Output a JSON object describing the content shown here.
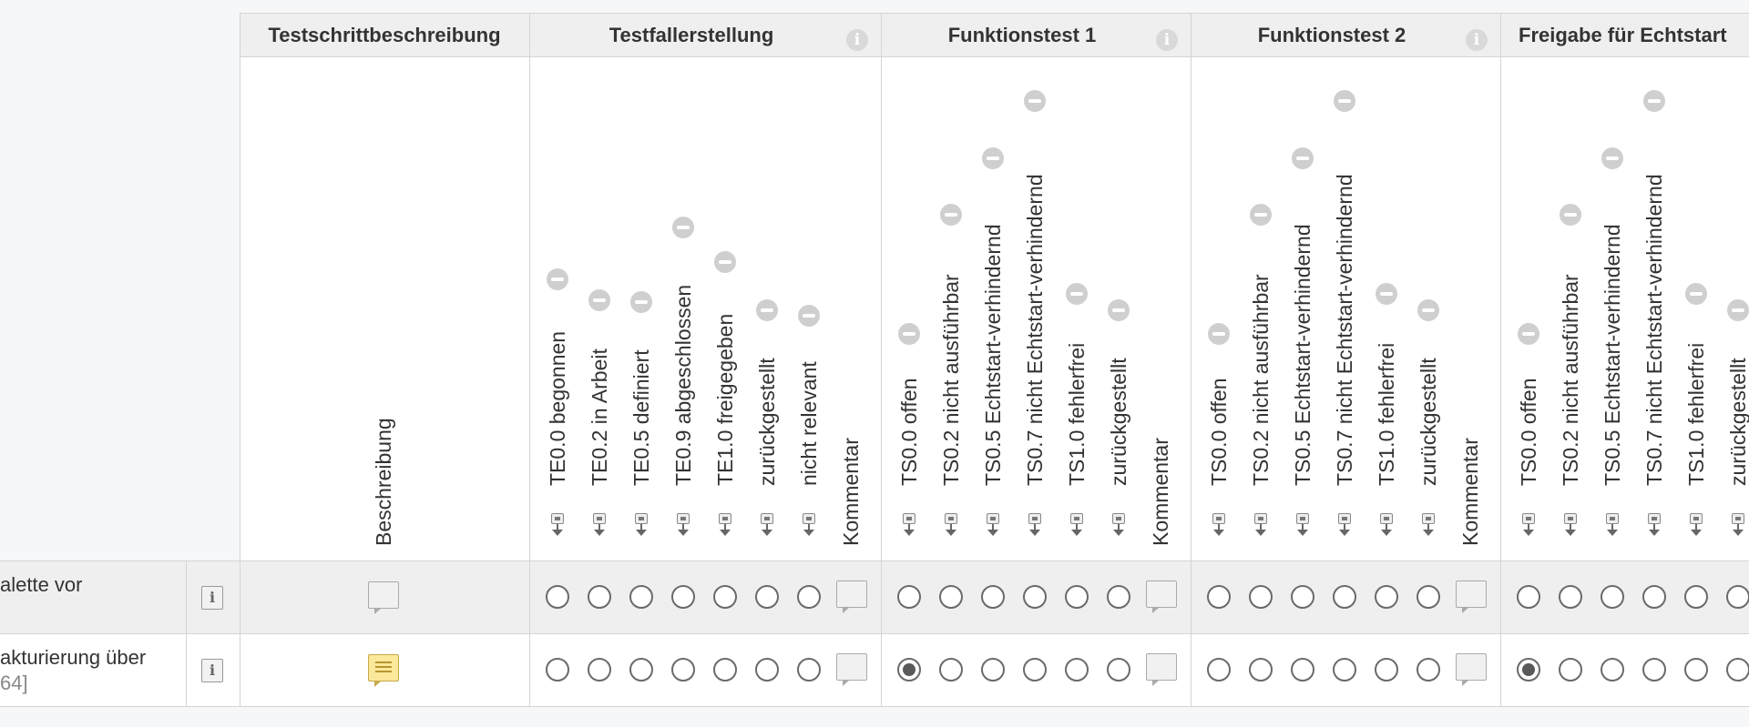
{
  "groups": [
    {
      "key": "beschreibung",
      "title": "Testschrittbeschreibung",
      "info": false
    },
    {
      "key": "testfall",
      "title": "Testfallerstellung",
      "info": true
    },
    {
      "key": "ft1",
      "title": "Funktionstest 1",
      "info": true
    },
    {
      "key": "ft2",
      "title": "Funktionstest 2",
      "info": true
    },
    {
      "key": "echt",
      "title": "Freigabe für Echtstart",
      "info": true
    }
  ],
  "column_headers": {
    "beschreibung": [
      "Beschreibung"
    ],
    "testfall": [
      "TE0.0 begonnen",
      "TE0.2 in Arbeit",
      "TE0.5 definiert",
      "TE0.9 abgeschlossen",
      "TE1.0 freigegeben",
      "zurückgestellt",
      "nicht relevant",
      "Kommentar"
    ],
    "ft1": [
      "TS0.0 offen",
      "TS0.2 nicht ausführbar",
      "TS0.5 Echtstart-verhindernd",
      "TS0.7 nicht Echtstart-verhindernd",
      "TS1.0 fehlerfrei",
      "zurückgestellt",
      "Kommentar"
    ],
    "ft2": [
      "TS0.0 offen",
      "TS0.2 nicht ausführbar",
      "TS0.5 Echtstart-verhindernd",
      "TS0.7 nicht Echtstart-verhindernd",
      "TS1.0 fehlerfrei",
      "zurückgestellt",
      "Kommentar"
    ],
    "echt": [
      "TS0.0 offen",
      "TS0.2 nicht ausführbar",
      "TS0.5 Echtstart-verhindernd",
      "TS0.7 nicht Echtstart-verhindernd",
      "TS1.0 fehlerfrei",
      "zurückgestellt"
    ]
  },
  "rows": [
    {
      "label_line1": "alette vor",
      "label_line2": "",
      "description_filled": false,
      "testfall_selected": -1,
      "ft1_selected": -1,
      "ft2_selected": -1,
      "echt_selected": -1
    },
    {
      "label_line1": "akturierung über",
      "label_line2": "64]",
      "description_filled": true,
      "testfall_selected": -1,
      "ft1_selected": 0,
      "ft2_selected": -1,
      "echt_selected": 0
    }
  ],
  "icons": {
    "info": "info-icon",
    "deselect": "minus-circle-icon",
    "sort": "sort-down-icon",
    "row_detail": "document-info-icon",
    "comment": "comment-bubble-icon"
  },
  "colors": {
    "header_bg": "#efefef",
    "row_alt_bg": "#efefef",
    "border": "#d4d4d4",
    "comment_filled": "#fbe89a"
  }
}
